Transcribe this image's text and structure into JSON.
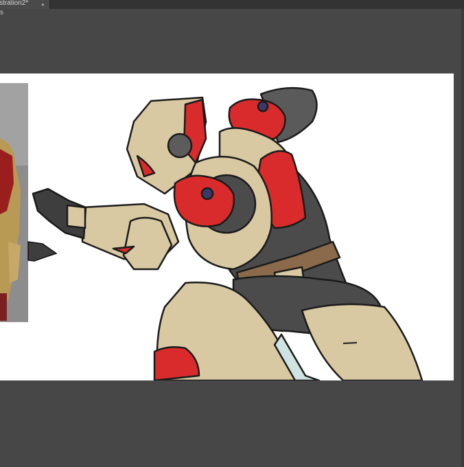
{
  "document_tabs": [
    {
      "label": "stration2*",
      "close_glyph": "●"
    }
  ],
  "doc_area": {
    "top_left_fragment": "s"
  },
  "artwork": {
    "description": "",
    "layers": [
      "reference-photo",
      "robot-illustration"
    ]
  },
  "colors": {
    "workspace_bg": "#474747",
    "tabbar_bg": "#333333",
    "canvas_bg": "#ffffff",
    "armor_tan": "#d9c9a3",
    "armor_red": "#d92b2b",
    "under_suit": "#4b4b4b",
    "outline": "#1a1a1a"
  }
}
